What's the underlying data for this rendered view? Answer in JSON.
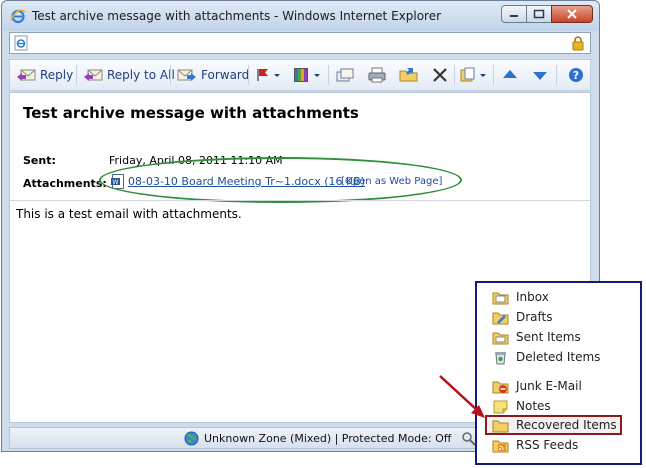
{
  "window": {
    "title": "Test archive message with attachments - Windows Internet Explorer"
  },
  "toolbar": {
    "reply_label": "Reply",
    "reply_all_label": "Reply to All",
    "forward_label": "Forward"
  },
  "message": {
    "subject": "Test archive message with attachments",
    "sent_label": "Sent:",
    "sent_value": "Friday, April 08, 2011 11:10 AM",
    "attachments_label": "Attachments:",
    "attachment_name": "08-03-10 Board Meeting Tr~1.docx (16 KB)",
    "attachment_web": "[Open as Web Page]",
    "body": "This is a test email with attachments."
  },
  "statusbar": {
    "zone_text": "Unknown Zone (Mixed) | Protected Mode: Off"
  },
  "folders": {
    "items": [
      {
        "label": "Inbox"
      },
      {
        "label": "Drafts"
      },
      {
        "label": "Sent Items"
      },
      {
        "label": "Deleted Items"
      },
      {
        "label": "Junk E-Mail"
      },
      {
        "label": "Notes"
      },
      {
        "label": "Recovered Items"
      },
      {
        "label": "RSS Feeds"
      }
    ]
  },
  "colors": {
    "highlight_ellipse": "#2e8f3a",
    "folder_highlight": "#8b1a1a",
    "arrow": "#b5121b",
    "panel_border": "#141c7a",
    "link": "#1e4fa1"
  }
}
